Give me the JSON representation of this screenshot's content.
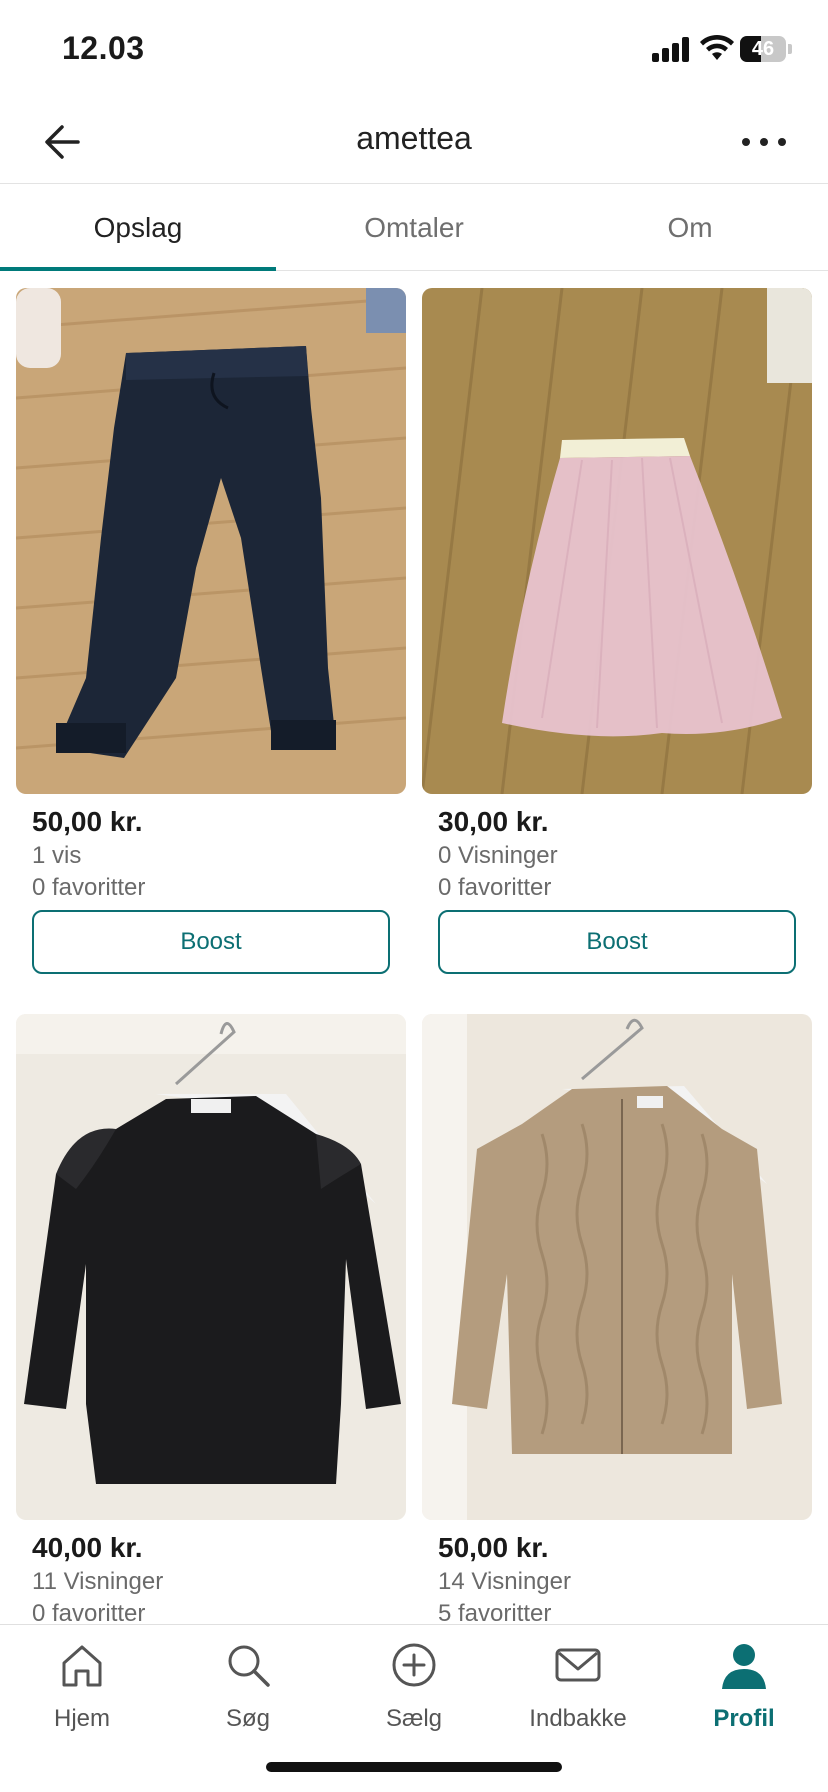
{
  "status_bar": {
    "time": "12.03",
    "battery": "46",
    "battery_level": 0.46
  },
  "header": {
    "title": "amettea",
    "back_icon": "arrow-left-icon",
    "more_icon": "more-horizontal-icon"
  },
  "tabs": [
    {
      "label": "Opslag",
      "active": true
    },
    {
      "label": "Omtaler",
      "active": false
    },
    {
      "label": "Om",
      "active": false
    }
  ],
  "listings": [
    {
      "price": "50,00 kr.",
      "views": "1 vis",
      "favorites": "0 favoritter",
      "boost_label": "Boost",
      "image": "navy-jogger-pants"
    },
    {
      "price": "30,00 kr.",
      "views": "0 Visninger",
      "favorites": "0 favoritter",
      "boost_label": "Boost",
      "image": "pink-tulle-skirt"
    },
    {
      "price": "40,00 kr.",
      "views": "11 Visninger",
      "favorites": "0 favoritter",
      "image": "black-ruffle-sweater"
    },
    {
      "price": "50,00 kr.",
      "views": "14 Visninger",
      "favorites": "5 favoritter",
      "image": "beige-cable-knit-cardigan"
    }
  ],
  "bottom_nav": [
    {
      "label": "Hjem",
      "icon": "home-icon",
      "active": false
    },
    {
      "label": "Søg",
      "icon": "search-icon",
      "active": false
    },
    {
      "label": "Sælg",
      "icon": "plus-circle-icon",
      "active": false
    },
    {
      "label": "Indbakke",
      "icon": "mail-icon",
      "active": false
    },
    {
      "label": "Profil",
      "icon": "profile-icon",
      "active": true
    }
  ],
  "colors": {
    "accent": "#0c6f73",
    "text": "#1a1a1a",
    "muted": "#6a6a6a"
  }
}
